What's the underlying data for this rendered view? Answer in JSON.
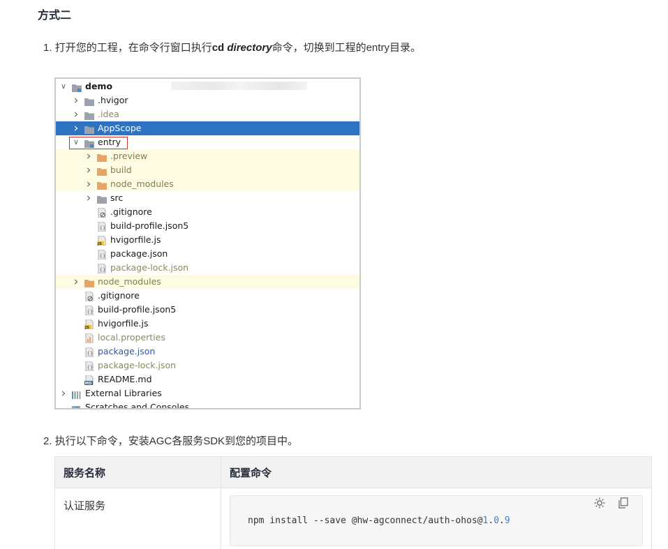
{
  "section_title": "方式二",
  "step1": {
    "num": "1.",
    "text_a": "打开您的工程，在命令行窗口执行",
    "cmd": "cd",
    "arg": "directory",
    "text_b": "命令，切换到工程的entry目录。"
  },
  "tree": {
    "rows": [
      {
        "label": "demo",
        "indent": 0,
        "arrow": "down",
        "icon": "module-folder",
        "bold": true
      },
      {
        "label": ".hvigor",
        "indent": 1,
        "arrow": "right",
        "icon": "folder-gray"
      },
      {
        "label": ".idea",
        "indent": 1,
        "arrow": "right",
        "icon": "folder-gray",
        "style": "olive"
      },
      {
        "label": "AppScope",
        "indent": 1,
        "arrow": "right",
        "icon": "folder-gray",
        "hl": "blue"
      },
      {
        "label": "entry",
        "indent": 1,
        "arrow": "down",
        "icon": "module-folder"
      },
      {
        "label": ".preview",
        "indent": 2,
        "arrow": "right",
        "icon": "folder-orange",
        "hl": "yellow",
        "style": "muted"
      },
      {
        "label": "build",
        "indent": 2,
        "arrow": "right",
        "icon": "folder-orange",
        "hl": "yellow",
        "style": "muted"
      },
      {
        "label": "node_modules",
        "indent": 2,
        "arrow": "right",
        "icon": "folder-orange",
        "hl": "yellow",
        "style": "muted"
      },
      {
        "label": "src",
        "indent": 2,
        "arrow": "right",
        "icon": "folder-gray"
      },
      {
        "label": ".gitignore",
        "indent": 2,
        "icon": "file-ignore"
      },
      {
        "label": "build-profile.json5",
        "indent": 2,
        "icon": "file-json"
      },
      {
        "label": "hvigorfile.js",
        "indent": 2,
        "icon": "file-js"
      },
      {
        "label": "package.json",
        "indent": 2,
        "icon": "file-json"
      },
      {
        "label": "package-lock.json",
        "indent": 2,
        "icon": "file-json",
        "style": "olive"
      },
      {
        "label": "node_modules",
        "indent": 1,
        "arrow": "right",
        "icon": "folder-orange",
        "hl": "yellow",
        "style": "muted"
      },
      {
        "label": ".gitignore",
        "indent": 1,
        "icon": "file-ignore"
      },
      {
        "label": "build-profile.json5",
        "indent": 1,
        "icon": "file-json"
      },
      {
        "label": "hvigorfile.js",
        "indent": 1,
        "icon": "file-js"
      },
      {
        "label": "local.properties",
        "indent": 1,
        "icon": "file-props",
        "style": "olive"
      },
      {
        "label": "package.json",
        "indent": 1,
        "icon": "file-json",
        "style": "blue-text"
      },
      {
        "label": "package-lock.json",
        "indent": 1,
        "icon": "file-json",
        "style": "olive"
      },
      {
        "label": "README.md",
        "indent": 1,
        "icon": "file-md"
      },
      {
        "label": "External Libraries",
        "indent": 0,
        "arrow": "right",
        "icon": "libraries"
      },
      {
        "label": "Scratches and Consoles",
        "indent": 0,
        "icon": "scratches"
      }
    ]
  },
  "step2": {
    "num": "2.",
    "text": "执行以下命令，安装AGC各服务SDK到您的项目中。"
  },
  "table": {
    "headers": [
      "服务名称",
      "配置命令"
    ],
    "rows": [
      {
        "service": "认证服务",
        "cmd_prefix": "npm install --save @hw-agconnect/auth-ohos@",
        "ver_major": "1",
        "ver_minor": "0",
        "ver_patch": "9"
      }
    ]
  },
  "icons": {
    "theme_toggle": "sun-icon",
    "copy": "copy-icon"
  },
  "colors": {
    "selection": "#2d73c2",
    "excluded_bg": "#fdfce2",
    "folder_orange": "#e8a464",
    "folder_gray": "#9aa3ad",
    "highlight_box": "#d22b2b",
    "code_number": "#3a82c4"
  }
}
